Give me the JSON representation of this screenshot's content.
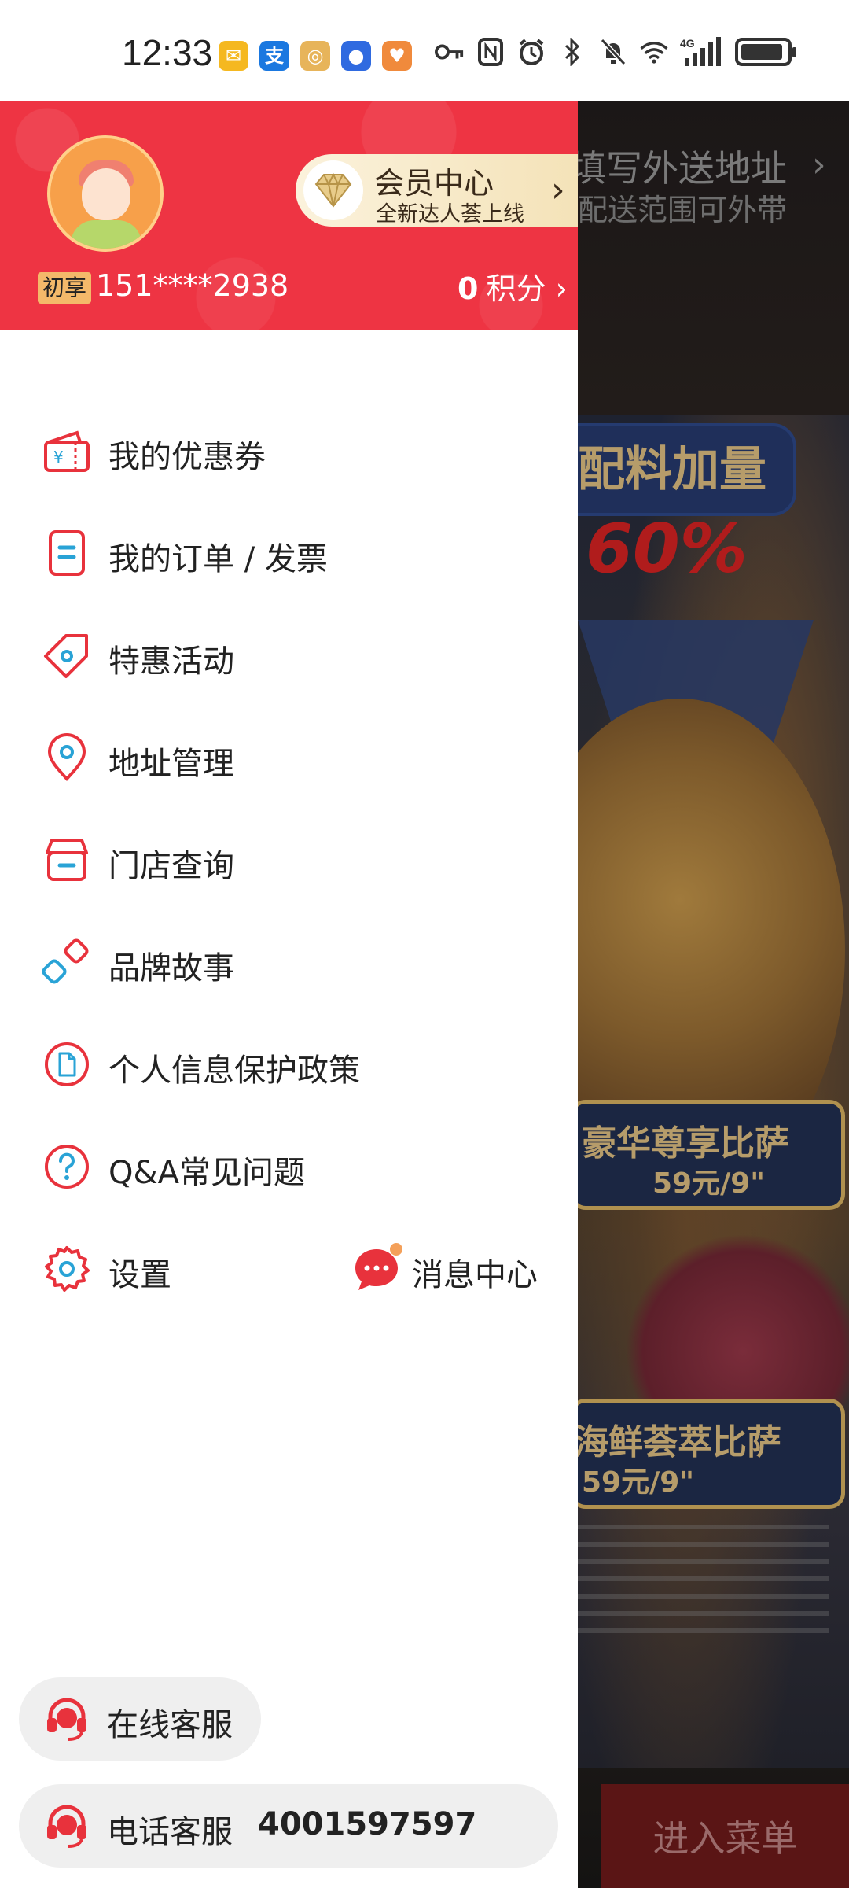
{
  "status_bar": {
    "time": "12:33",
    "notification_icons": [
      "mail-icon",
      "alipay-icon",
      "app-icon",
      "app-icon-blue",
      "app-icon-orange"
    ],
    "system_icons": [
      "key-icon",
      "nfc-icon",
      "alarm-icon",
      "bluetooth-icon",
      "mute-icon",
      "wifi-icon",
      "signal-4g-icon",
      "battery-icon"
    ],
    "network_label": "4G"
  },
  "drawer": {
    "header": {
      "badge": "初享",
      "phone": "151****2938",
      "member_card": {
        "title": "会员中心",
        "subtitle": "全新达人荟上线"
      },
      "points": {
        "value": "0",
        "label": "积分"
      }
    },
    "menu": [
      {
        "label": "我的优惠券",
        "icon": "coupon-icon"
      },
      {
        "label": "我的订单 / 发票",
        "icon": "order-icon"
      },
      {
        "label": "特惠活动",
        "icon": "tag-icon"
      },
      {
        "label": "地址管理",
        "icon": "location-icon"
      },
      {
        "label": "门店查询",
        "icon": "store-icon"
      },
      {
        "label": "品牌故事",
        "icon": "brand-icon"
      },
      {
        "label": "个人信息保护政策",
        "icon": "document-icon"
      },
      {
        "label": "Q&A常见问题",
        "icon": "question-icon"
      },
      {
        "label": "设置",
        "icon": "gear-icon"
      }
    ],
    "message_center": {
      "label": "消息中心",
      "icon": "chat-icon"
    },
    "customer_service": {
      "online_label": "在线客服",
      "phone_label": "电话客服",
      "phone_number": "4001597597"
    }
  },
  "background_page": {
    "address_title": "填写外送地址",
    "address_subtitle": "配送范围可外带",
    "promo_title": "配料加量",
    "promo_percent": "60%",
    "pizza1_name": "豪华尊享比萨",
    "pizza1_price": "59元/9\"",
    "pizza2_name": "海鲜荟萃比萨",
    "pizza2_price": "59元/9\"",
    "enter_menu": "进入菜单"
  },
  "colors": {
    "brand_red": "#ee3443",
    "icon_red": "#e8323c",
    "icon_blue": "#29a3d6",
    "pill_bg": "#efefef"
  }
}
